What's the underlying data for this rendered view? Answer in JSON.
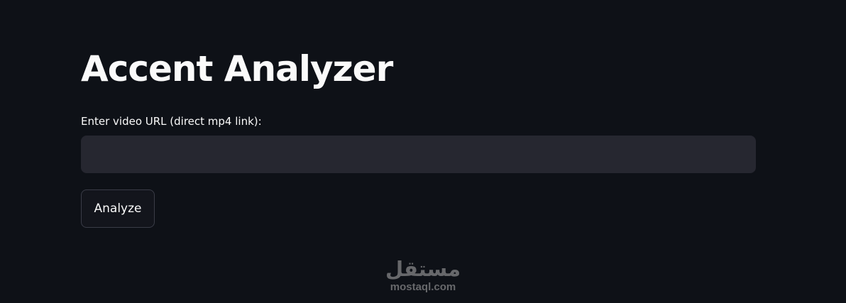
{
  "app": {
    "title": "Accent Analyzer"
  },
  "form": {
    "url_label": "Enter video URL (direct mp4 link):",
    "url_value": "",
    "url_placeholder": "",
    "analyze_label": "Analyze"
  },
  "watermark": {
    "logo": "مستقل",
    "domain": "mostaql.com"
  },
  "colors": {
    "background": "#0e1117",
    "text": "#fafafa",
    "input_background": "#262730",
    "button_border": "#3a3c47"
  }
}
